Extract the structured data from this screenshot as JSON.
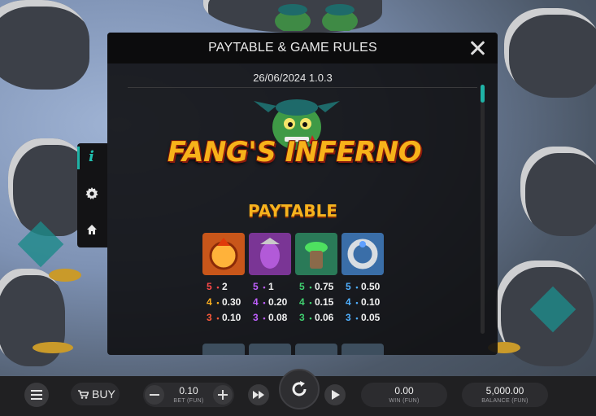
{
  "modal": {
    "title": "PAYTABLE & GAME RULES",
    "version": "26/06/2024 1.0.3"
  },
  "logo": {
    "text": "FANG'S INFERNO",
    "icon": "goblin-mascot"
  },
  "paytable": {
    "title": "PAYTABLE",
    "symbols": [
      {
        "name": "fire-dragon-symbol",
        "color": "#e05a1c",
        "pays": [
          {
            "count": "5",
            "value": "2",
            "color": "#ff4a4a"
          },
          {
            "count": "4",
            "value": "0.30",
            "color": "#ffb020"
          },
          {
            "count": "3",
            "value": "0.10",
            "color": "#ff5a3a"
          }
        ]
      },
      {
        "name": "purple-gem-symbol",
        "color": "#9a3fb4",
        "pays": [
          {
            "count": "5",
            "value": "1",
            "color": "#c060ff"
          },
          {
            "count": "4",
            "value": "0.20",
            "color": "#c060ff"
          },
          {
            "count": "3",
            "value": "0.08",
            "color": "#c060ff"
          }
        ]
      },
      {
        "name": "green-potion-symbol",
        "color": "#2f8a5a",
        "pays": [
          {
            "count": "5",
            "value": "0.75",
            "color": "#40d070"
          },
          {
            "count": "4",
            "value": "0.15",
            "color": "#40d070"
          },
          {
            "count": "3",
            "value": "0.06",
            "color": "#40d070"
          }
        ]
      },
      {
        "name": "silver-ring-symbol",
        "color": "#3f78b0",
        "pays": [
          {
            "count": "5",
            "value": "0.50",
            "color": "#50b0ff"
          },
          {
            "count": "4",
            "value": "0.10",
            "color": "#50b0ff"
          },
          {
            "count": "3",
            "value": "0.05",
            "color": "#50b0ff"
          }
        ]
      }
    ]
  },
  "sidenav": {
    "info_glyph": "i",
    "items": [
      "info-icon",
      "gear-icon",
      "home-icon"
    ]
  },
  "bottombar": {
    "buy_label": "BUY",
    "bet_value": "0.10",
    "bet_label": "BET (FUN)",
    "win_value": "0.00",
    "win_label": "WIN (FUN)",
    "balance_value": "5,000.00",
    "balance_label": "BALANCE (FUN)",
    "icons": [
      "menu-icon",
      "cart-icon",
      "minus-icon",
      "plus-icon",
      "fast-forward-icon",
      "spin-icon",
      "autoplay-icon"
    ]
  },
  "colors": {
    "accent": "#1fb3a6",
    "gold": "#f6b31e"
  }
}
